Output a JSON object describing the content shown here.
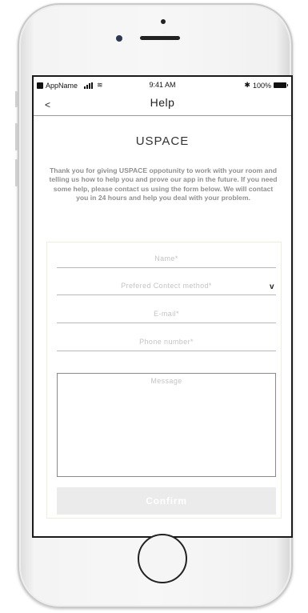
{
  "status_bar": {
    "carrier": "AppName",
    "time": "9:41 AM",
    "battery": "100%"
  },
  "nav": {
    "back_label": "<",
    "title": "Help"
  },
  "brand": "USPACE",
  "intro_text": "Thank you for giving USPACE oppotunity to work with your room and telling us how to help you and prove our app in the future. If you need some help, please contact us using the form below. We will contact you in 24 hours and help you deal with your problem.",
  "form": {
    "name_placeholder": "Name*",
    "contact_method_placeholder": "Prefered Contect method*",
    "dropdown_chevron": "v",
    "email_placeholder": "E-mail*",
    "phone_placeholder": "Phone number*",
    "message_placeholder": "Message",
    "confirm_label": "Confirm"
  },
  "icons": {
    "signal": "signal-icon",
    "wifi": "wifi-icon",
    "bluetooth": "bluetooth-icon",
    "battery": "battery-icon"
  }
}
